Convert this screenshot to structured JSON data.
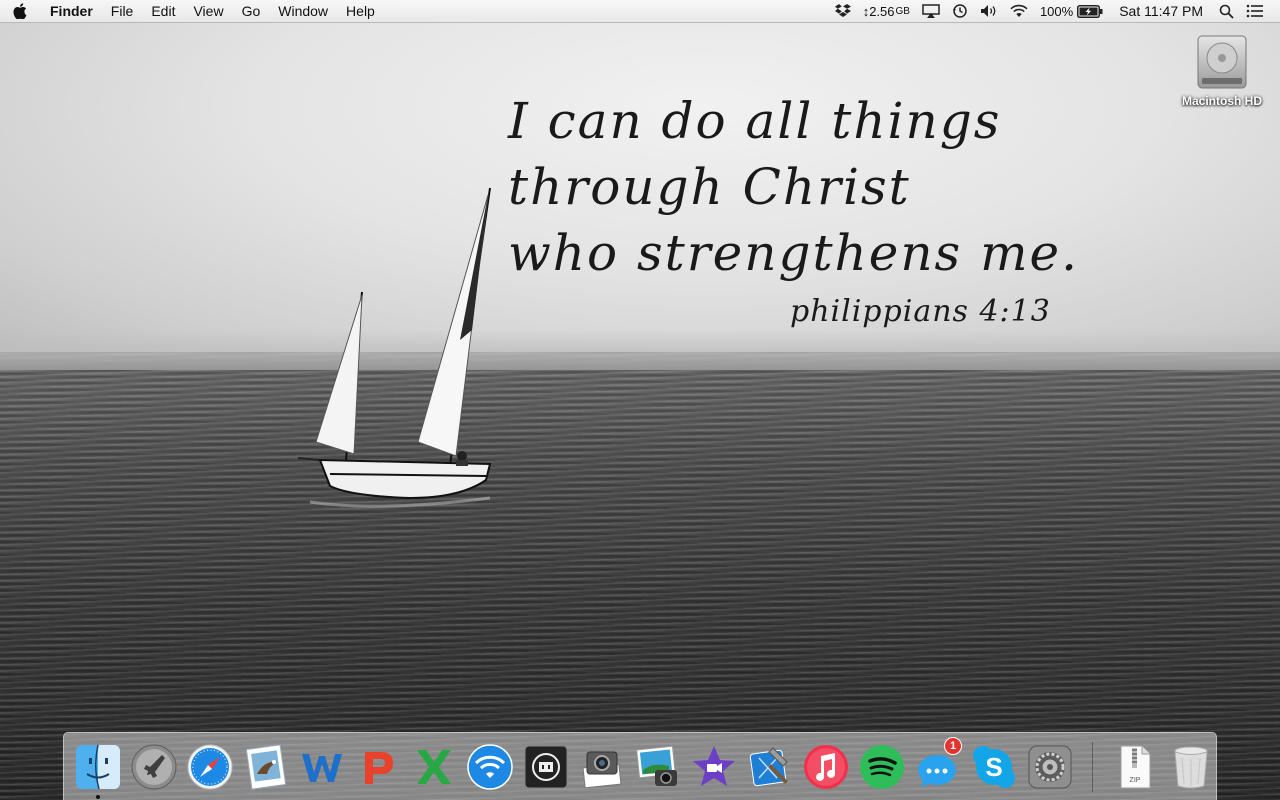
{
  "menubar": {
    "app_name": "Finder",
    "menus": [
      "File",
      "Edit",
      "View",
      "Go",
      "Window",
      "Help"
    ],
    "status": {
      "memory_value": "↕2.56",
      "memory_unit": "GB",
      "battery_percent": "100%",
      "clock": "Sat 11:47 PM"
    }
  },
  "wallpaper": {
    "quote_lines": [
      "I can do all things",
      "through Christ",
      "who strengthens me."
    ],
    "reference": "philippians 4:13"
  },
  "desktop": {
    "icons": [
      {
        "label": "Macintosh HD",
        "icon": "hard-drive-icon"
      }
    ]
  },
  "dock": {
    "apps": [
      {
        "name": "finder",
        "icon": "finder-icon",
        "running": true
      },
      {
        "name": "launchpad",
        "icon": "launchpad-icon"
      },
      {
        "name": "safari",
        "icon": "safari-icon"
      },
      {
        "name": "mail",
        "icon": "mail-icon"
      },
      {
        "name": "word",
        "icon": "word-icon"
      },
      {
        "name": "powerpoint",
        "icon": "powerpoint-icon"
      },
      {
        "name": "excel",
        "icon": "excel-icon"
      },
      {
        "name": "wifi-utility",
        "icon": "wifi-app-icon"
      },
      {
        "name": "network",
        "icon": "network-app-icon"
      },
      {
        "name": "image-capture",
        "icon": "image-capture-icon"
      },
      {
        "name": "iphoto",
        "icon": "iphoto-icon"
      },
      {
        "name": "imovie",
        "icon": "imovie-icon"
      },
      {
        "name": "xcode",
        "icon": "xcode-icon"
      },
      {
        "name": "itunes",
        "icon": "itunes-icon"
      },
      {
        "name": "spotify",
        "icon": "spotify-icon"
      },
      {
        "name": "messages",
        "icon": "messages-icon",
        "badge": "1"
      },
      {
        "name": "skype",
        "icon": "skype-icon"
      },
      {
        "name": "system-preferences",
        "icon": "system-preferences-icon"
      }
    ],
    "stack": {
      "label": "ZIP",
      "icon": "zip-archive-icon"
    },
    "trash": {
      "icon": "trash-icon"
    }
  },
  "colors": {
    "menubar_bg": "#efefef",
    "safari_blue": "#1e88e5",
    "powerpoint_red": "#e8412c",
    "excel_green": "#27a844",
    "itunes_red": "#f2304b",
    "spotify_green": "#2ebd59",
    "skype_blue": "#12a5e8",
    "badge_red": "#e3342f"
  }
}
